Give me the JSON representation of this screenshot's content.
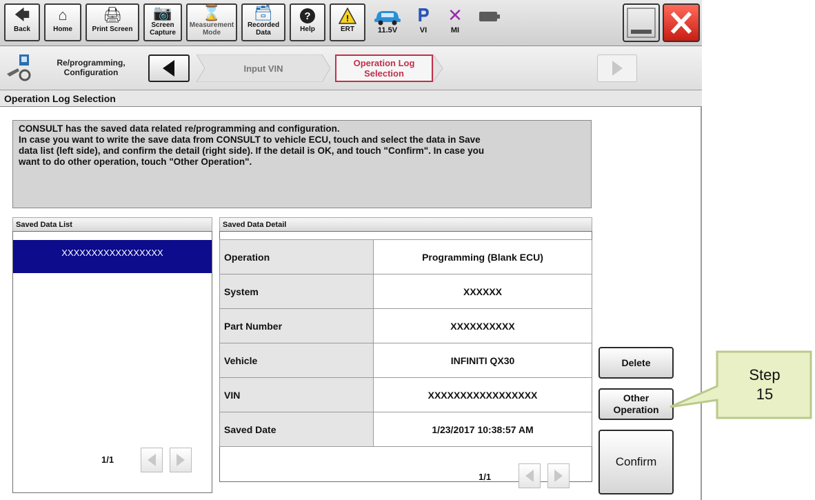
{
  "toolbar": {
    "back": "Back",
    "home": "Home",
    "print_screen": "Print Screen",
    "screen_capture_1": "Screen",
    "screen_capture_2": "Capture",
    "measurement_mode_1": "Measurement",
    "measurement_mode_2": "Mode",
    "recorded_data_1": "Recorded",
    "recorded_data_2": "Data",
    "help": "Help",
    "ert": "ERT",
    "voltage": "11.5V",
    "vi": "VI",
    "mi": "MI"
  },
  "nav": {
    "module_1": "Re/programming,",
    "module_2": "Configuration",
    "step_input_vin": "Input VIN",
    "step_current_1": "Operation Log",
    "step_current_2": "Selection"
  },
  "page": {
    "title": "Operation Log Selection",
    "message_1": "CONSULT has the saved data related re/programming and configuration.",
    "message_2": "In case you want to write the save data from CONSULT to vehicle ECU, touch and select the data in Save",
    "message_3": "data list (left side), and confirm the detail (right side). If the detail is OK, and touch \"Confirm\".  In case you",
    "message_4": "want to do other operation, touch \"Other Operation\"."
  },
  "saved_list": {
    "header": "Saved Data List",
    "items": [
      "XXXXXXXXXXXXXXXXX"
    ],
    "pager": "1/1"
  },
  "detail": {
    "header": "Saved Data Detail",
    "rows": [
      {
        "label": "Operation",
        "value": "Programming (Blank ECU)"
      },
      {
        "label": "System",
        "value": "XXXXXX"
      },
      {
        "label": "Part Number",
        "value": "XXXXXXXXXX"
      },
      {
        "label": "Vehicle",
        "value": "INFINITI QX30"
      },
      {
        "label": "VIN",
        "value": "XXXXXXXXXXXXXXXXX"
      },
      {
        "label": "Saved Date",
        "value": "1/23/2017 10:38:57 AM"
      }
    ],
    "pager": "1/1"
  },
  "actions": {
    "delete": "Delete",
    "other_1": "Other",
    "other_2": "Operation",
    "confirm": "Confirm"
  },
  "callout": {
    "line1": "Step",
    "line2": "15"
  },
  "colors": {
    "selected_row": "#0c0c8c",
    "current_step_border": "#c0304a",
    "close_red": "#e02020",
    "callout_fill": "#e9f0c6",
    "callout_border": "#b9c98a"
  }
}
